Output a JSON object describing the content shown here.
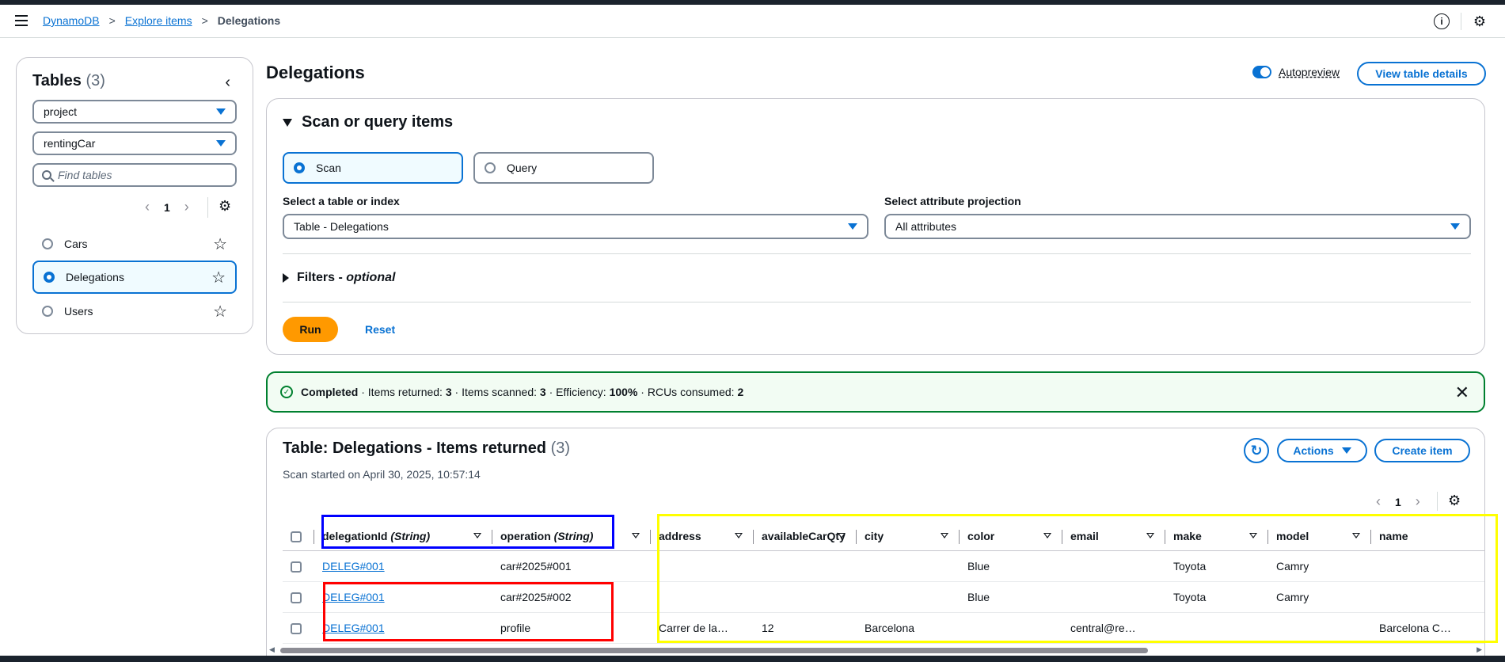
{
  "breadcrumb": {
    "root": "DynamoDB",
    "middle": "Explore items",
    "current": "Delegations",
    "sep": ">"
  },
  "header_icons": {
    "info": "i",
    "settings": "⚙"
  },
  "left_panel": {
    "title": "Tables",
    "count": "(3)",
    "collapse": "‹",
    "filter1": "project",
    "filter2": "rentingCar",
    "search_placeholder": "Find tables",
    "page": "1",
    "prev": "‹",
    "next": "›",
    "tables": [
      {
        "name": "Cars",
        "selected": false
      },
      {
        "name": "Delegations",
        "selected": true
      },
      {
        "name": "Users",
        "selected": false
      }
    ],
    "star": "☆"
  },
  "main": {
    "title": "Delegations",
    "autopreview_label": "Autopreview",
    "view_details": "View table details"
  },
  "scan_panel": {
    "title": "Scan or query items",
    "scan_label": "Scan",
    "query_label": "Query",
    "table_index_label": "Select a table or index",
    "table_index_value": "Table - Delegations",
    "projection_label": "Select attribute projection",
    "projection_value": "All attributes",
    "filters_label": "Filters",
    "filters_suffix": "optional",
    "filters_dash": " - ",
    "run": "Run",
    "reset": "Reset"
  },
  "flash": {
    "completed": "Completed",
    "items_returned_label": " · Items returned: ",
    "items_returned": "3",
    "items_scanned_label": " · Items scanned: ",
    "items_scanned": "3",
    "efficiency_label": " · Efficiency: ",
    "efficiency": "100%",
    "rcus_label": " · RCUs consumed: ",
    "rcus": "2",
    "close": "✕",
    "check": "✓"
  },
  "results": {
    "title": "Table: Delegations - Items returned",
    "count": "(3)",
    "subtitle": "Scan started on April 30, 2025, 10:57:14",
    "refresh": "↻",
    "actions": "Actions",
    "create": "Create item",
    "page": "1",
    "prev": "‹",
    "next": "›",
    "columns": [
      {
        "name": "delegationId",
        "type": "(String)"
      },
      {
        "name": "operation",
        "type": "(String)"
      },
      {
        "name": "address",
        "type": ""
      },
      {
        "name": "availableCarQty",
        "type": ""
      },
      {
        "name": "city",
        "type": ""
      },
      {
        "name": "color",
        "type": ""
      },
      {
        "name": "email",
        "type": ""
      },
      {
        "name": "make",
        "type": ""
      },
      {
        "name": "model",
        "type": ""
      },
      {
        "name": "name",
        "type": ""
      }
    ],
    "rows": [
      {
        "delegationId": "DELEG#001",
        "operation": "car#2025#001",
        "address": "",
        "availableCarQty": "",
        "city": "",
        "color": "Blue",
        "email": "",
        "make": "Toyota",
        "model": "Camry",
        "name": ""
      },
      {
        "delegationId": "DELEG#001",
        "operation": "car#2025#002",
        "address": "",
        "availableCarQty": "",
        "city": "",
        "color": "Blue",
        "email": "",
        "make": "Toyota",
        "model": "Camry",
        "name": ""
      },
      {
        "delegationId": "DELEG#001",
        "operation": "profile",
        "address": "Carrer de la…",
        "availableCarQty": "12",
        "city": "Barcelona",
        "color": "",
        "email": "central@re…",
        "make": "",
        "model": "",
        "name": "Barcelona C…"
      }
    ]
  },
  "colors": {
    "accent": "#0972d3",
    "run": "#ff9900",
    "success": "#00802f",
    "hl_blue": "#0000ff",
    "hl_red": "#ff0000",
    "hl_yellow": "#ffff00"
  }
}
